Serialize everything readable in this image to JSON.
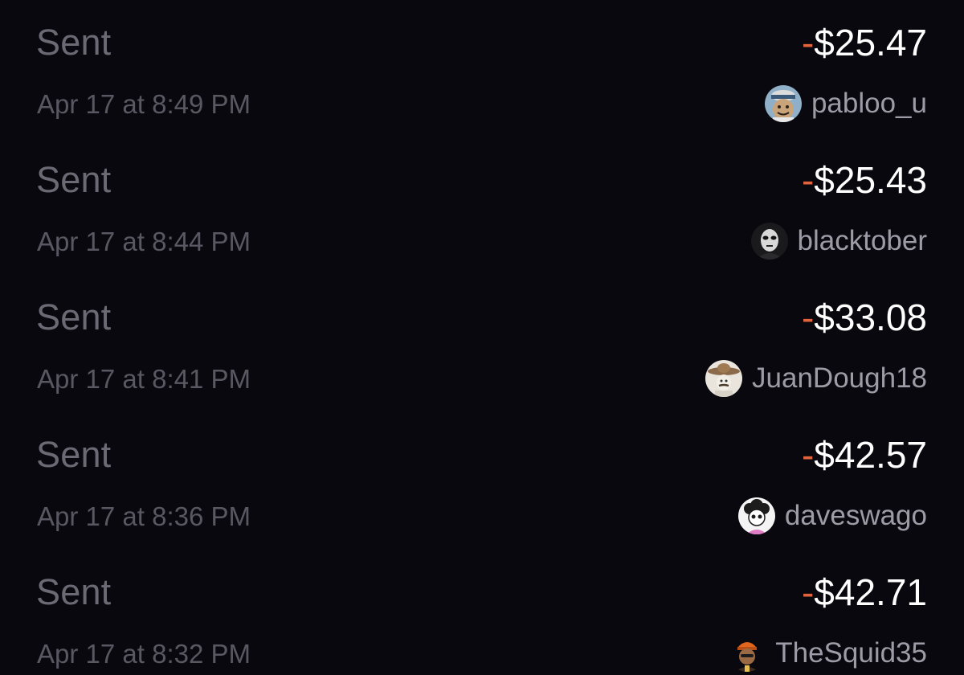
{
  "colors": {
    "background": "#09080e",
    "type_label": "#6b6a74",
    "date_text": "#595862",
    "amount_text": "#ffffff",
    "minus_sign": "#e2643d",
    "username_text": "#9d9ca6"
  },
  "transactions": [
    {
      "type": "Sent",
      "date": "Apr 17 at 8:49 PM",
      "sign": "-",
      "amount": "$25.47",
      "username": "pabloo_u",
      "avatar_icon": "cartoon-face-avatar-icon"
    },
    {
      "type": "Sent",
      "date": "Apr 17 at 8:44 PM",
      "sign": "-",
      "amount": "$25.43",
      "username": "blacktober",
      "avatar_icon": "masked-figure-avatar-icon"
    },
    {
      "type": "Sent",
      "date": "Apr 17 at 8:41 PM",
      "sign": "-",
      "amount": "$33.08",
      "username": "JuanDough18",
      "avatar_icon": "sombrero-avatar-icon"
    },
    {
      "type": "Sent",
      "date": "Apr 17 at 8:36 PM",
      "sign": "-",
      "amount": "$42.57",
      "username": "daveswago",
      "avatar_icon": "curly-hair-cartoon-avatar-icon"
    },
    {
      "type": "Sent",
      "date": "Apr 17 at 8:32 PM",
      "sign": "-",
      "amount": "$42.71",
      "username": "TheSquid35",
      "avatar_icon": "orange-cap-cartoon-avatar-icon"
    }
  ]
}
